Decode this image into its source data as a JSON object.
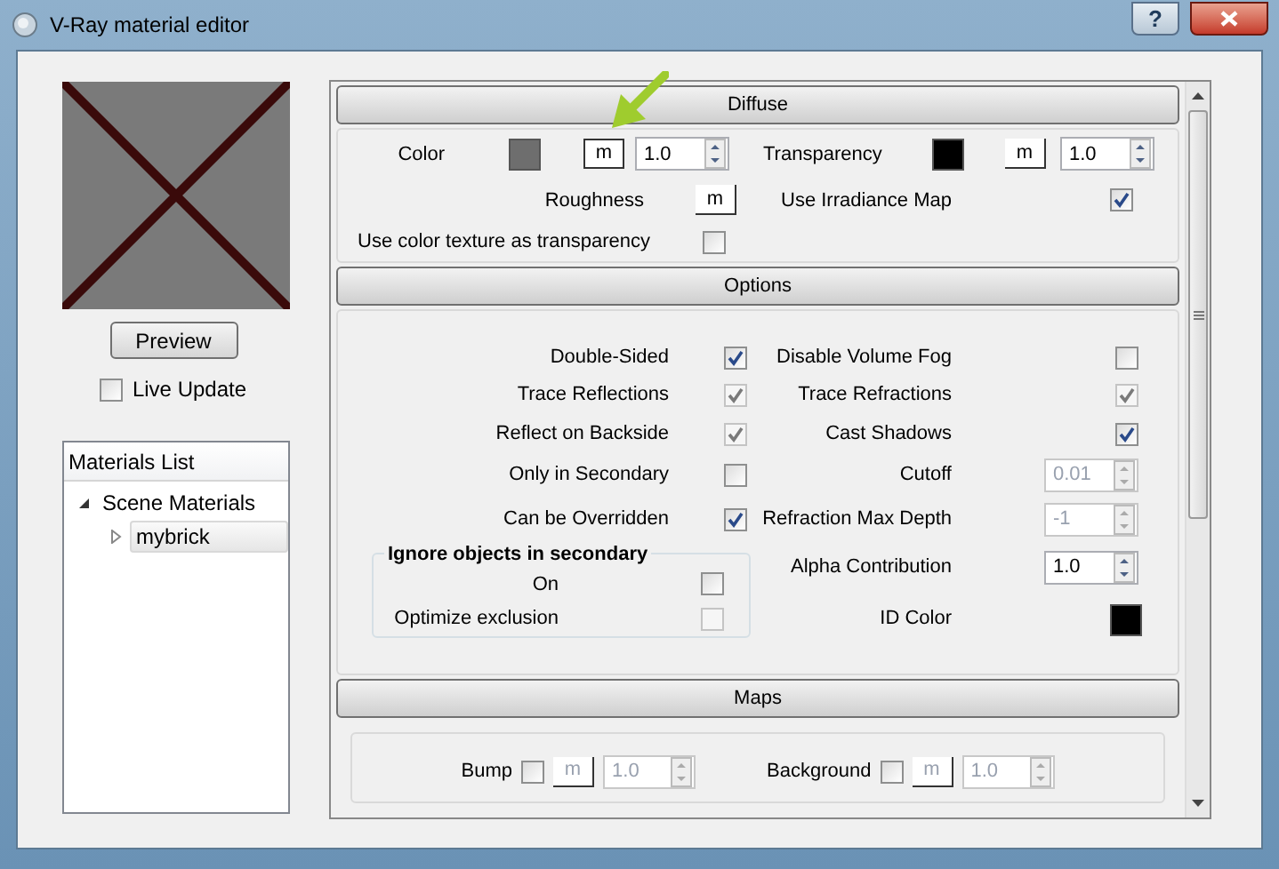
{
  "window": {
    "title": "V-Ray material editor",
    "help": "?"
  },
  "preview": {
    "button": "Preview",
    "live_update": {
      "label": "Live Update",
      "checked": false
    }
  },
  "materials_list": {
    "header": "Materials List",
    "tree": [
      {
        "label": "Scene Materials",
        "expanded": true,
        "selected": false,
        "children": [
          {
            "label": "mybrick",
            "expanded": false,
            "selected": true
          }
        ]
      }
    ]
  },
  "diffuse": {
    "title": "Diffuse",
    "color": {
      "label": "Color",
      "color": "#6e6e6e",
      "map": "m",
      "amount": "1.0"
    },
    "transparency": {
      "label": "Transparency",
      "color": "#000000",
      "map": "m",
      "amount": "1.0"
    },
    "roughness": {
      "label": "Roughness",
      "map": "m"
    },
    "use_irradiance_map": {
      "label": "Use Irradiance Map",
      "checked": true
    },
    "color_texture_transparency": {
      "label": "Use color texture as transparency",
      "checked": false
    }
  },
  "options": {
    "title": "Options",
    "left": [
      {
        "label": "Double-Sided",
        "checked": true,
        "disabled": false
      },
      {
        "label": "Trace Reflections",
        "checked": true,
        "disabled": true
      },
      {
        "label": "Reflect on Backside",
        "checked": true,
        "disabled": true
      },
      {
        "label": "Only in Secondary",
        "checked": false,
        "disabled": false
      },
      {
        "label": "Can be Overridden",
        "checked": true,
        "disabled": false
      }
    ],
    "ignore_group": {
      "title": "Ignore objects in secondary",
      "items": [
        {
          "label": "On",
          "checked": false,
          "disabled": false
        },
        {
          "label": "Optimize exclusion",
          "checked": false,
          "disabled": true
        }
      ]
    },
    "right": [
      {
        "kind": "checkbox",
        "label": "Disable Volume Fog",
        "checked": false,
        "disabled": false
      },
      {
        "kind": "checkbox",
        "label": "Trace Refractions",
        "checked": true,
        "disabled": true
      },
      {
        "kind": "checkbox",
        "label": "Cast Shadows",
        "checked": true,
        "disabled": false
      },
      {
        "kind": "spinner",
        "label": "Cutoff",
        "value": "0.01",
        "disabled": true
      },
      {
        "kind": "spinner",
        "label": "Refraction Max Depth",
        "value": "-1",
        "disabled": true
      },
      {
        "kind": "spinner",
        "label": "Alpha Contribution",
        "value": "1.0",
        "disabled": false
      },
      {
        "kind": "swatch",
        "label": "ID Color",
        "color": "#000000"
      }
    ]
  },
  "maps": {
    "title": "Maps",
    "items": [
      {
        "label": "Bump",
        "checked": false,
        "map": "m",
        "amount": "1.0"
      },
      {
        "label": "Background",
        "checked": false,
        "map": "m",
        "amount": "1.0"
      }
    ]
  }
}
